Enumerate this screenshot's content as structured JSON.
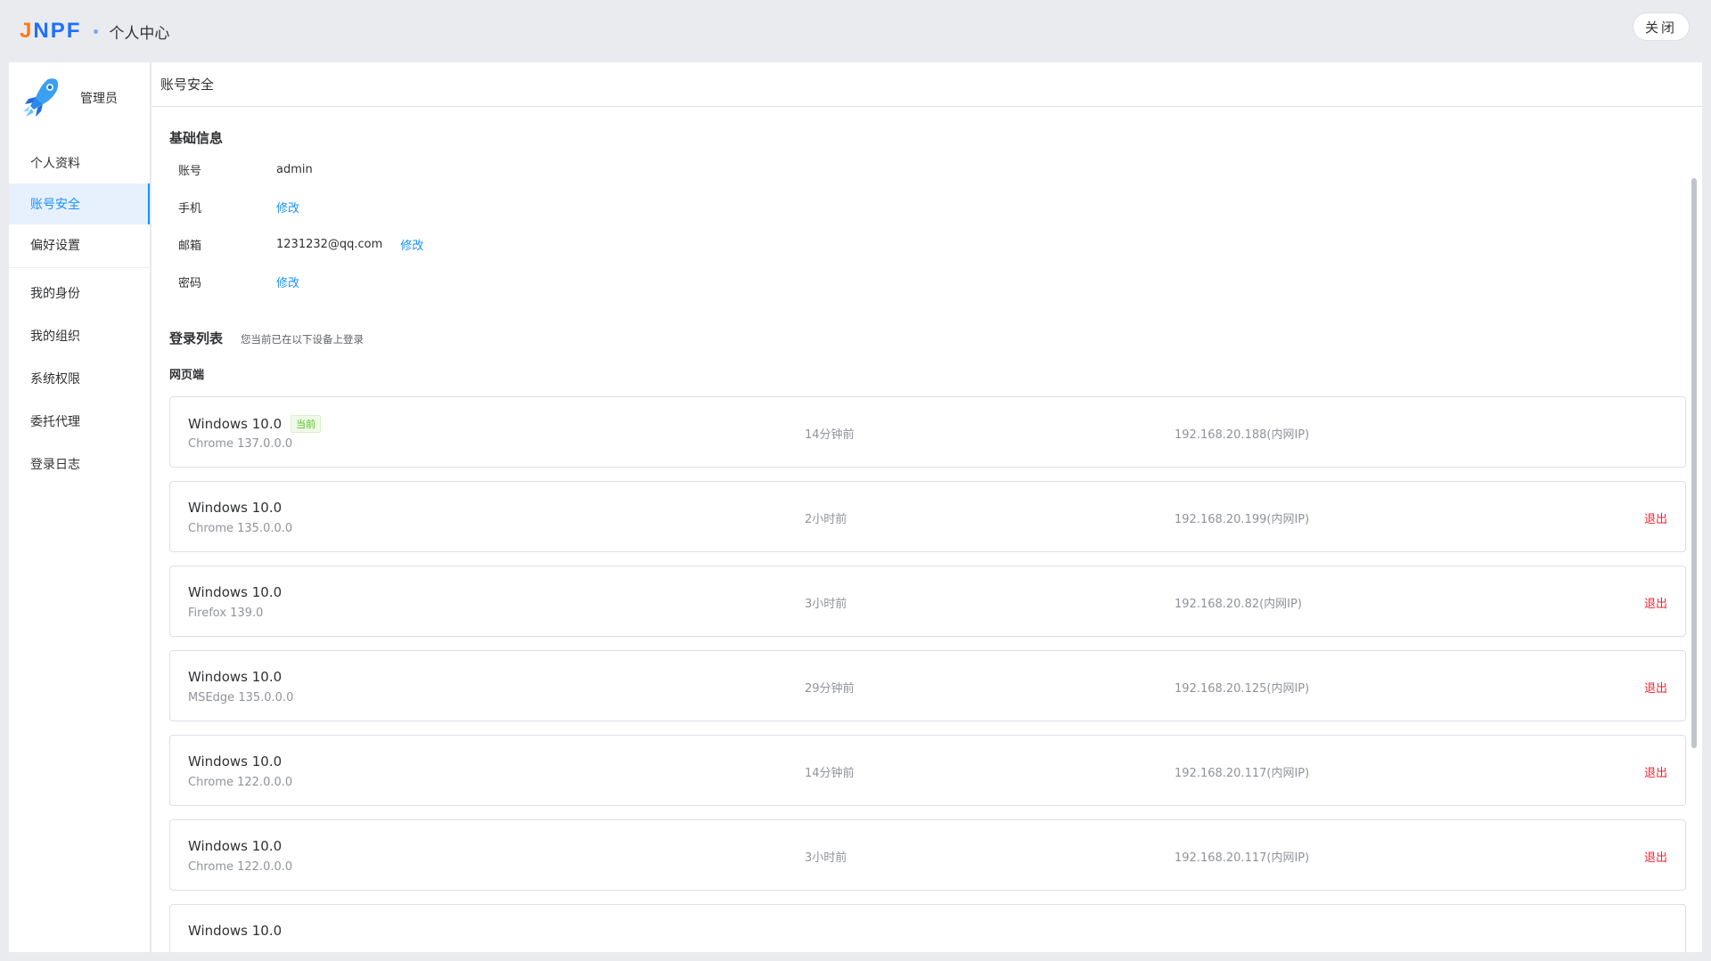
{
  "header": {
    "logo_text": [
      "J",
      "N",
      "P",
      "F"
    ],
    "title": "个人中心",
    "close_label": "关闭"
  },
  "sidebar": {
    "profile_name": "管理员",
    "items": [
      {
        "label": "个人资料"
      },
      {
        "label": "账号安全",
        "active": true
      },
      {
        "label": "偏好设置"
      },
      {
        "label": "我的身份"
      },
      {
        "label": "我的组织"
      },
      {
        "label": "系统权限"
      },
      {
        "label": "委托代理"
      },
      {
        "label": "登录日志"
      }
    ]
  },
  "main": {
    "title": "账号安全",
    "basic": {
      "title": "基础信息",
      "account_label": "账号",
      "account_value": "admin",
      "phone_label": "手机",
      "phone_action": "修改",
      "email_label": "邮箱",
      "email_value": "1231232@qq.com",
      "email_action": "修改",
      "password_label": "密码",
      "password_action": "修改"
    },
    "login": {
      "title": "登录列表",
      "subtitle": "您当前已在以下设备上登录",
      "web_title": "网页端",
      "current_tag": "当前",
      "logout_label": "退出",
      "sessions": [
        {
          "os": "Windows 10.0",
          "browser": "Chrome 137.0.0.0",
          "time": "14分钟前",
          "ip": "192.168.20.188(内网IP)",
          "current": true
        },
        {
          "os": "Windows 10.0",
          "browser": "Chrome 135.0.0.0",
          "time": "2小时前",
          "ip": "192.168.20.199(内网IP)"
        },
        {
          "os": "Windows 10.0",
          "browser": "Firefox 139.0",
          "time": "3小时前",
          "ip": "192.168.20.82(内网IP)"
        },
        {
          "os": "Windows 10.0",
          "browser": "MSEdge 135.0.0.0",
          "time": "29分钟前",
          "ip": "192.168.20.125(内网IP)"
        },
        {
          "os": "Windows 10.0",
          "browser": "Chrome 122.0.0.0",
          "time": "14分钟前",
          "ip": "192.168.20.117(内网IP)"
        },
        {
          "os": "Windows 10.0",
          "browser": "Chrome 122.0.0.0",
          "time": "3小时前",
          "ip": "192.168.20.117(内网IP)"
        },
        {
          "os": "Windows 10.0",
          "browser": "",
          "time": "",
          "ip": ""
        }
      ]
    }
  }
}
